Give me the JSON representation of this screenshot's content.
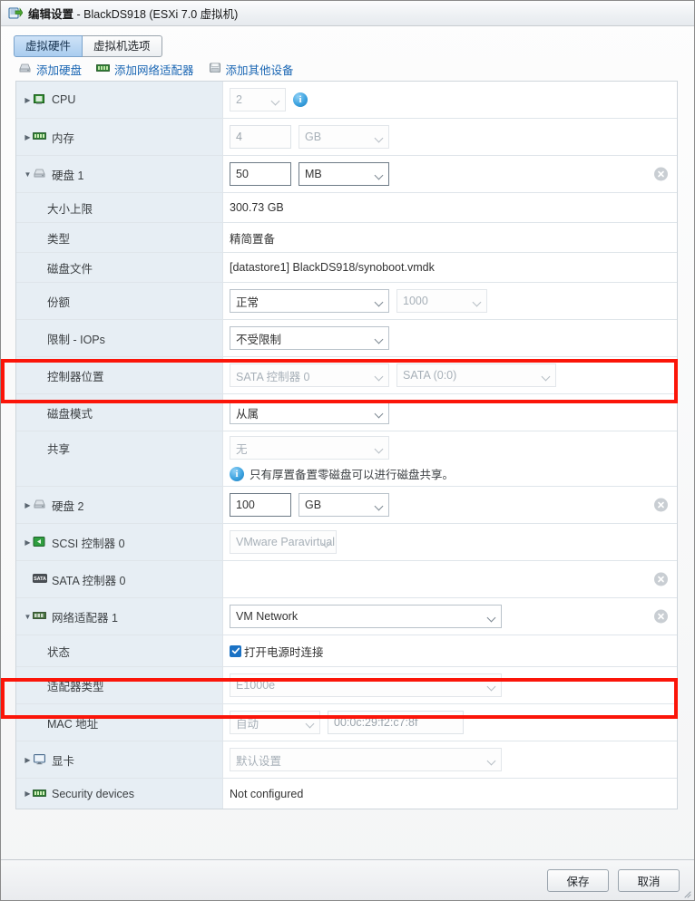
{
  "window": {
    "title_main": "编辑设置",
    "title_sub": " - BlackDS918 (ESXi 7.0 虚拟机)",
    "icon": "vm-edit-icon"
  },
  "tabs": [
    {
      "label": "虚拟硬件",
      "active": true
    },
    {
      "label": "虚拟机选项",
      "active": false
    }
  ],
  "toolbar": [
    {
      "label": "添加硬盘",
      "icon": "hard-disk-icon"
    },
    {
      "label": "添加网络适配器",
      "icon": "network-adapter-icon"
    },
    {
      "label": "添加其他设备",
      "icon": "other-device-icon"
    }
  ],
  "rows": {
    "cpu": {
      "label": "CPU",
      "value": "2"
    },
    "memory": {
      "label": "内存",
      "value": "4",
      "unit": "GB"
    },
    "hdd1": {
      "label": "硬盘 1",
      "value": "50",
      "unit": "MB"
    },
    "max_size": {
      "label": "大小上限",
      "value": "300.73 GB"
    },
    "type": {
      "label": "类型",
      "value": "精简置备"
    },
    "disk_file": {
      "label": "磁盘文件",
      "value": "[datastore1] BlackDS918/synoboot.vmdk"
    },
    "shares": {
      "label": "份额",
      "value": "正常",
      "value2": "1000"
    },
    "limit_iops": {
      "label": "限制 - IOPs",
      "value": "不受限制"
    },
    "controller_location": {
      "label": "控制器位置",
      "value": "SATA 控制器 0",
      "value2": "SATA (0:0)"
    },
    "disk_mode": {
      "label": "磁盘模式",
      "value": "从属"
    },
    "sharing": {
      "label": "共享",
      "value": "无",
      "note": "只有厚置备置零磁盘可以进行磁盘共享。"
    },
    "hdd2": {
      "label": "硬盘 2",
      "value": "100",
      "unit": "GB"
    },
    "scsi": {
      "label": "SCSI 控制器 0",
      "value": "VMware Paravirtual"
    },
    "sata": {
      "label": "SATA 控制器 0",
      "value": ""
    },
    "netadapter1": {
      "label": "网络适配器 1",
      "value": "VM Network"
    },
    "status": {
      "label": "状态",
      "checkbox_label": "打开电源时连接",
      "checked": true
    },
    "adapter_type": {
      "label": "适配器类型",
      "value": "E1000e"
    },
    "mac": {
      "label": "MAC 地址",
      "value": "自动",
      "value2": "00:0c:29:f2:c7:8f"
    },
    "video": {
      "label": "显卡",
      "value": "默认设置"
    },
    "security": {
      "label": "Security devices",
      "value": "Not configured"
    }
  },
  "highlights": [
    {
      "name": "controller-location-highlight",
      "color": "#fb1509"
    },
    {
      "name": "adapter-type-highlight",
      "color": "#fb1509"
    }
  ],
  "footer": {
    "save_label": "保存",
    "cancel_label": "取消"
  }
}
